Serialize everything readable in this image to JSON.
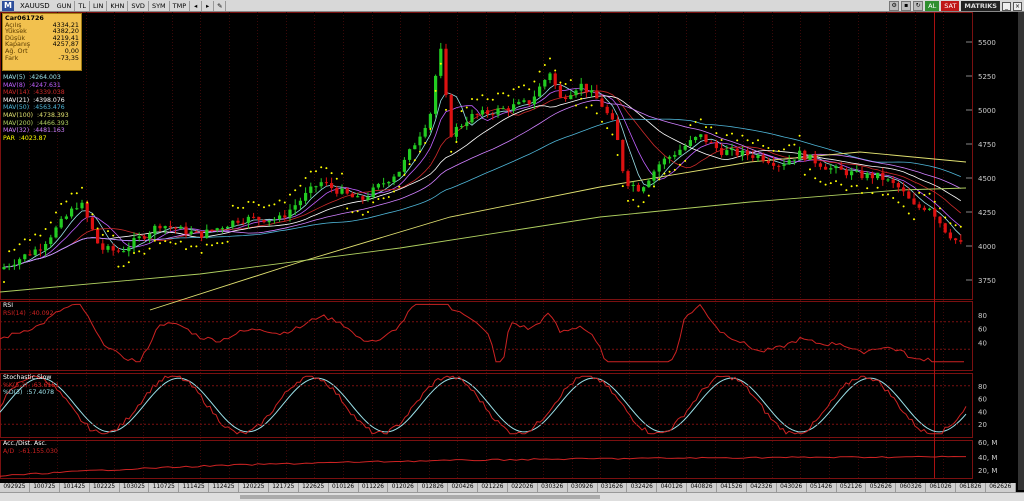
{
  "toolbar": {
    "logo": "M",
    "symbol": "XAUUSD",
    "buttons": [
      "GUN",
      "TL",
      "LIN",
      "KHN",
      "SVD",
      "SYM",
      "TMP"
    ],
    "al_label": "AL",
    "sat_label": "SAT",
    "brand": "MATRIKS"
  },
  "infobox": {
    "title": "Car061726",
    "rows": [
      {
        "label": "Açılış",
        "value": "4334,21"
      },
      {
        "label": "Yüksek",
        "value": "4382,20"
      },
      {
        "label": "Düşük",
        "value": "4219,41"
      },
      {
        "label": "Kapanış",
        "value": "4257,87"
      },
      {
        "label": "Ağ. Ort",
        "value": "0,00"
      },
      {
        "label": "Fark",
        "value": "-73,35"
      }
    ]
  },
  "price_legend": [
    {
      "label": "MAV(5)",
      "value": ":4264.003",
      "color": "#9be0e8"
    },
    {
      "label": "MAV(8)",
      "value": ":4247.631",
      "color": "#c060ff"
    },
    {
      "label": "MAV(14)",
      "value": ":4339.038",
      "color": "#cc2a2a"
    },
    {
      "label": "MAV(21)",
      "value": ":4398.076",
      "color": "#ffffff"
    },
    {
      "label": "MAV(50)",
      "value": ":4563.476",
      "color": "#4fb6d8"
    },
    {
      "label": "MAV(100)",
      "value": ":4738.393",
      "color": "#e0e070"
    },
    {
      "label": "MAV(200)",
      "value": ":4466.393",
      "color": "#b0d060"
    },
    {
      "label": "MAV(32)",
      "value": ":4481.163",
      "color": "#d080ff"
    },
    {
      "label": "PAR",
      "value": ":4023.87",
      "color": "#ffff00"
    }
  ],
  "rsi_legend": [
    {
      "label": "RSI",
      "value": "",
      "color": "#ffffff"
    },
    {
      "label": "RSI(14)",
      "value": ":40.092",
      "color": "#cc2222"
    }
  ],
  "stoch_legend": [
    {
      "label": "Stochastic Slow",
      "value": "",
      "color": "#ffffff"
    },
    {
      "label": "%K(5,3)",
      "value": ":63.6151",
      "color": "#cc2222"
    },
    {
      "label": "%D(3)",
      "value": ":57.4078",
      "color": "#9be0e8"
    }
  ],
  "ad_legend": [
    {
      "label": "Acc./Dist. Asc.",
      "value": "",
      "color": "#ffffff"
    },
    {
      "label": "A/D",
      "value": ":-61.155.030",
      "color": "#cc2222"
    }
  ],
  "price_axis": [
    "5500",
    "5250",
    "5000",
    "4750",
    "4500",
    "4250",
    "4000",
    "3750"
  ],
  "rsi_axis": [
    "80",
    "60",
    "40"
  ],
  "stoch_axis": [
    "80",
    "60",
    "40",
    "20"
  ],
  "ad_axis": [
    "60, M",
    "40, M",
    "20, M"
  ],
  "dates": [
    "092925",
    "100725",
    "101425",
    "102225",
    "103025",
    "110725",
    "111425",
    "112425",
    "120225",
    "121725",
    "122625",
    "010126",
    "011226",
    "012026",
    "012826",
    "020426",
    "021226",
    "022026",
    "030326",
    "030926",
    "031626",
    "032426",
    "040126",
    "040826",
    "041526",
    "042326",
    "043026",
    "051426",
    "052126",
    "052626",
    "060326",
    "061026",
    "061826",
    "062626"
  ],
  "colors": {
    "up": "#22cc22",
    "down": "#dd1111",
    "sar": "#ffff00",
    "grid": "#7a1010"
  }
}
